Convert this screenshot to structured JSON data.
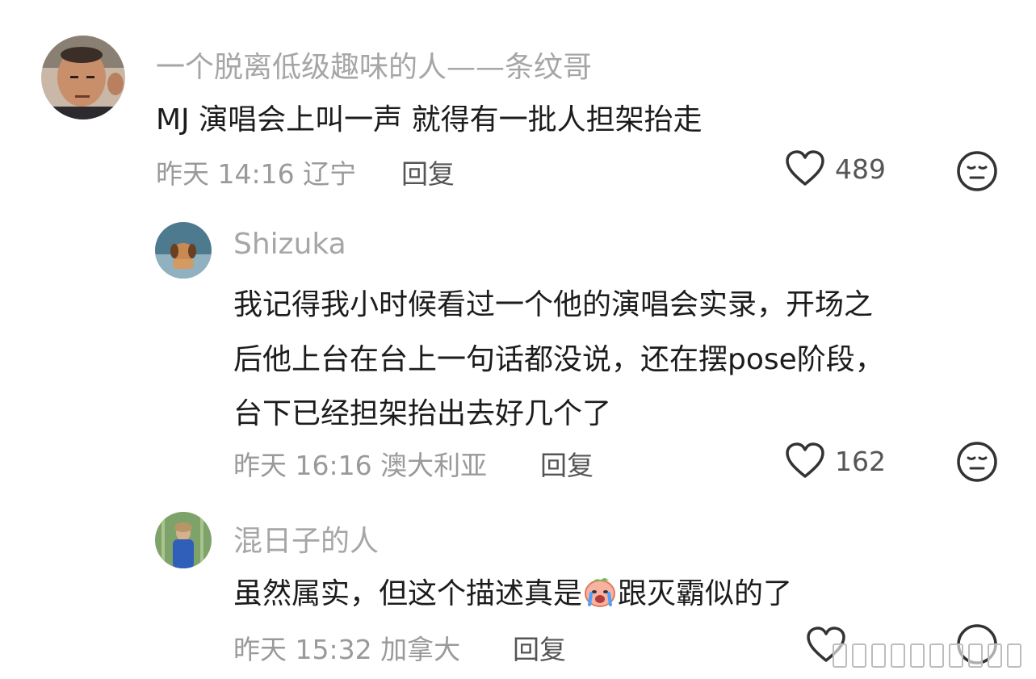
{
  "comments": [
    {
      "username": "一个脱离低级趣味的人——条纹哥",
      "text": "MJ 演唱会上叫一声 就得有一批人担架抬走",
      "time": "昨天 14:16",
      "location": "辽宁",
      "reply_label": "回复",
      "likes": "489"
    },
    {
      "username": "Shizuka",
      "lines": [
        "我记得我小时候看过一个他的演唱会实录，开场之",
        "后他上台在台上一句话都没说，还在摆pose阶段，",
        "台下已经担架抬出去好几个了"
      ],
      "time": "昨天 16:16",
      "location": "澳大利亚",
      "reply_label": "回复",
      "likes": "162"
    },
    {
      "username": "混日子的人",
      "text_before": "虽然属实，但这个描述真是",
      "emoji": "crying-peach-emoji",
      "text_after": "跟灭霸似的了",
      "time": "昨天 15:32",
      "location": "加拿大",
      "reply_label": "回复"
    }
  ],
  "icons": {
    "like": "heart-outline-icon",
    "reaction": "meh-face-icon"
  },
  "colors": {
    "username": "#a6a6a6",
    "meta": "#9a9a9a",
    "text": "#1c1c1c"
  }
}
